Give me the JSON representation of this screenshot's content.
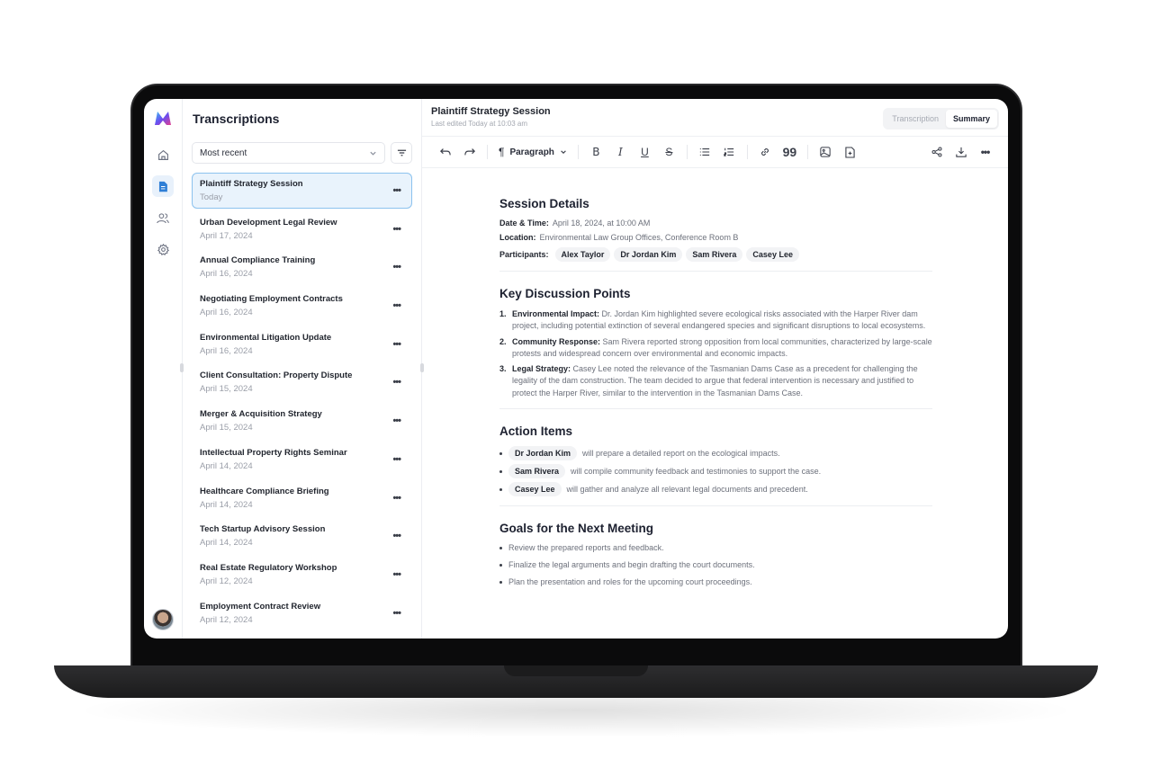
{
  "app": {
    "logo": "brand-logo"
  },
  "rail": {
    "items": [
      {
        "name": "home",
        "icon": "home-icon",
        "active": false
      },
      {
        "name": "transcriptions",
        "icon": "document-icon",
        "active": true
      },
      {
        "name": "contacts",
        "icon": "users-icon",
        "active": false
      },
      {
        "name": "settings",
        "icon": "gear-icon",
        "active": false
      }
    ],
    "avatar": "user-avatar"
  },
  "list": {
    "title": "Transcriptions",
    "sort": {
      "selected": "Most recent"
    },
    "items": [
      {
        "title": "Plaintiff Strategy Session",
        "date": "Today",
        "active": true
      },
      {
        "title": "Urban Development Legal Review",
        "date": "April 17, 2024"
      },
      {
        "title": "Annual Compliance Training",
        "date": "April 16, 2024"
      },
      {
        "title": "Negotiating Employment Contracts",
        "date": "April 16, 2024"
      },
      {
        "title": "Environmental Litigation Update",
        "date": "April 16, 2024"
      },
      {
        "title": "Client Consultation: Property Dispute",
        "date": "April 15, 2024"
      },
      {
        "title": "Merger & Acquisition Strategy",
        "date": "April 15, 2024"
      },
      {
        "title": "Intellectual Property Rights Seminar",
        "date": "April 14, 2024"
      },
      {
        "title": "Healthcare Compliance Briefing",
        "date": "April 14, 2024"
      },
      {
        "title": "Tech Startup Advisory Session",
        "date": "April 14, 2024"
      },
      {
        "title": "Real Estate Regulatory Workshop",
        "date": "April 12, 2024"
      },
      {
        "title": "Employment Contract Review",
        "date": "April 12, 2024"
      }
    ]
  },
  "editor": {
    "title": "Plaintiff Strategy Session",
    "subtitle": "Last edited Today at 10:03 am",
    "tabs": [
      {
        "label": "Transcription",
        "active": false
      },
      {
        "label": "Summary",
        "active": true
      }
    ],
    "toolbar": {
      "block_style": "Paragraph"
    }
  },
  "doc": {
    "session": {
      "heading": "Session Details",
      "datetime_label": "Date & Time:",
      "datetime": "April 18, 2024, at 10:00 AM",
      "location_label": "Location:",
      "location": "Environmental Law Group Offices, Conference Room B",
      "participants_label": "Participants:",
      "participants": [
        "Alex Taylor",
        "Dr Jordan Kim",
        "Sam Rivera",
        "Casey Lee"
      ]
    },
    "discussion": {
      "heading": "Key Discussion Points",
      "points": [
        {
          "n": "1.",
          "label": "Environmental Impact:",
          "text": "Dr. Jordan Kim highlighted severe ecological risks associated with the Harper River dam project, including potential extinction of several endangered species and significant disruptions to local ecosystems."
        },
        {
          "n": "2.",
          "label": "Community Response:",
          "text": "Sam Rivera reported strong opposition from local communities, characterized by large-scale protests and widespread concern over environmental and economic impacts."
        },
        {
          "n": "3.",
          "label": "Legal Strategy:",
          "text": "Casey Lee noted the relevance of the Tasmanian Dams Case as a precedent for challenging the legality of the dam construction. The team decided to argue that federal intervention is necessary and justified to protect the Harper River, similar to the intervention in the Tasmanian Dams Case."
        }
      ]
    },
    "actions": {
      "heading": "Action Items",
      "items": [
        {
          "person": "Dr Jordan Kim",
          "text": "will prepare a detailed report on the ecological impacts."
        },
        {
          "person": "Sam Rivera",
          "text": "will compile community feedback and testimonies to support the case."
        },
        {
          "person": "Casey Lee",
          "text": "will gather and analyze all relevant legal documents and precedent."
        }
      ]
    },
    "goals": {
      "heading": "Goals for the Next Meeting",
      "items": [
        "Review the prepared reports and feedback.",
        "Finalize the legal arguments and begin drafting the court documents.",
        "Plan the presentation and roles for the upcoming court proceedings."
      ]
    }
  }
}
